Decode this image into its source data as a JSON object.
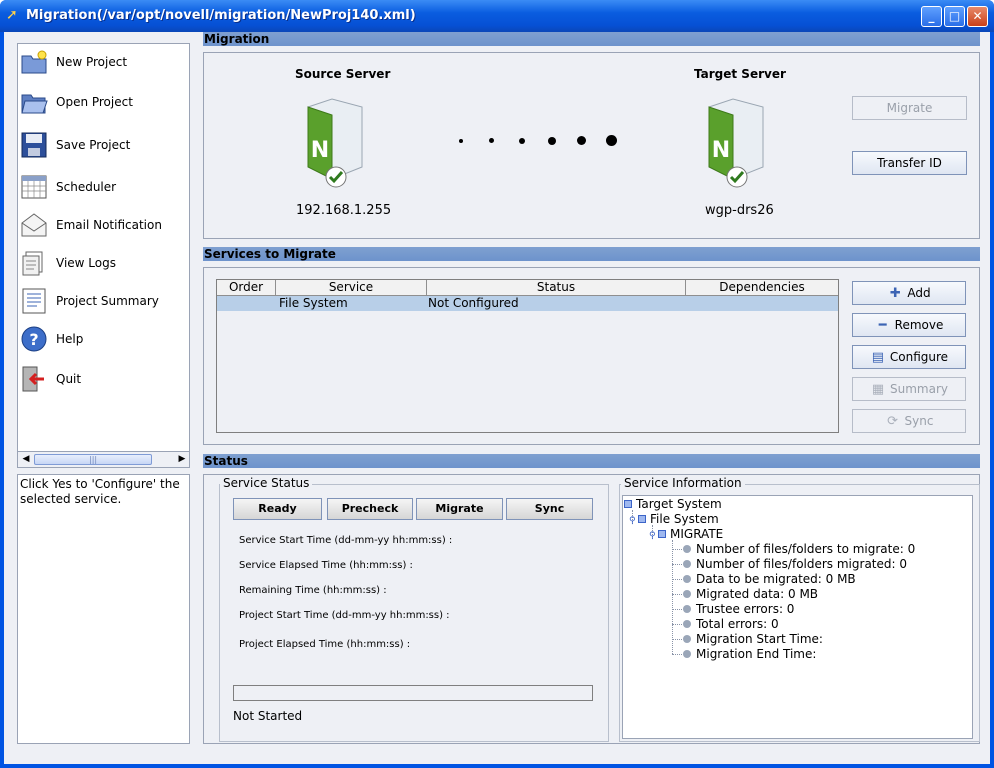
{
  "window": {
    "title": "Migration(/var/opt/novell/migration/NewProj140.xml)",
    "minimize": "_",
    "maximize": "□",
    "close": "✕"
  },
  "sidebar": {
    "items": [
      {
        "label": "New Project",
        "icon": "new-project-icon"
      },
      {
        "label": "Open Project",
        "icon": "open-folder-icon"
      },
      {
        "label": "Save Project",
        "icon": "floppy-disk-icon"
      },
      {
        "label": "Scheduler",
        "icon": "calendar-icon"
      },
      {
        "label": "Email Notification",
        "icon": "envelope-icon"
      },
      {
        "label": "View Logs",
        "icon": "logs-icon"
      },
      {
        "label": "Project Summary",
        "icon": "summary-icon"
      },
      {
        "label": "Help",
        "icon": "help-icon"
      },
      {
        "label": "Quit",
        "icon": "quit-icon"
      }
    ],
    "hint": "Click Yes to 'Configure' the selected service."
  },
  "migration": {
    "header": "Migration",
    "source_title": "Source Server",
    "source_ip": "192.168.1.255",
    "target_title": "Target Server",
    "target_name": "wgp-drs26",
    "migrate_button": "Migrate",
    "transfer_button": "Transfer ID",
    "server_letter": "N"
  },
  "services": {
    "header": "Services to Migrate",
    "columns": [
      "Order",
      "Service",
      "Status",
      "Dependencies"
    ],
    "rows": [
      {
        "order": "",
        "service": "File System",
        "status": "Not Configured",
        "dependencies": ""
      }
    ],
    "buttons": {
      "add": "Add",
      "remove": "Remove",
      "configure": "Configure",
      "summary": "Summary",
      "sync": "Sync"
    }
  },
  "status": {
    "header": "Status",
    "service_status_title": "Service Status",
    "phase_buttons": [
      "Ready",
      "Precheck",
      "Migrate",
      "Sync"
    ],
    "fields": [
      "Service Start Time (dd-mm-yy hh:mm:ss) :",
      "Service Elapsed Time (hh:mm:ss) :",
      "Remaining Time (hh:mm:ss) :",
      "Project Start Time (dd-mm-yy hh:mm:ss) :",
      "Project Elapsed Time (hh:mm:ss) :"
    ],
    "progress_percent": 0,
    "state_text": "Not Started",
    "service_info_title": "Service Information",
    "tree": {
      "root": "Target System",
      "child": "File System",
      "grandchild": "MIGRATE",
      "leaves": [
        "Number of files/folders to migrate: 0",
        "Number of files/folders migrated: 0",
        "Data to be migrated: 0 MB",
        "Migrated data: 0 MB",
        "Trustee errors: 0",
        "Total errors: 0",
        "Migration Start Time:",
        "Migration End Time:"
      ]
    }
  },
  "colors": {
    "titlebar": "#0a5de0",
    "section_header": "#7fa0d0",
    "selected_row": "#b8cfe8",
    "server_green": "#5aa02c"
  }
}
